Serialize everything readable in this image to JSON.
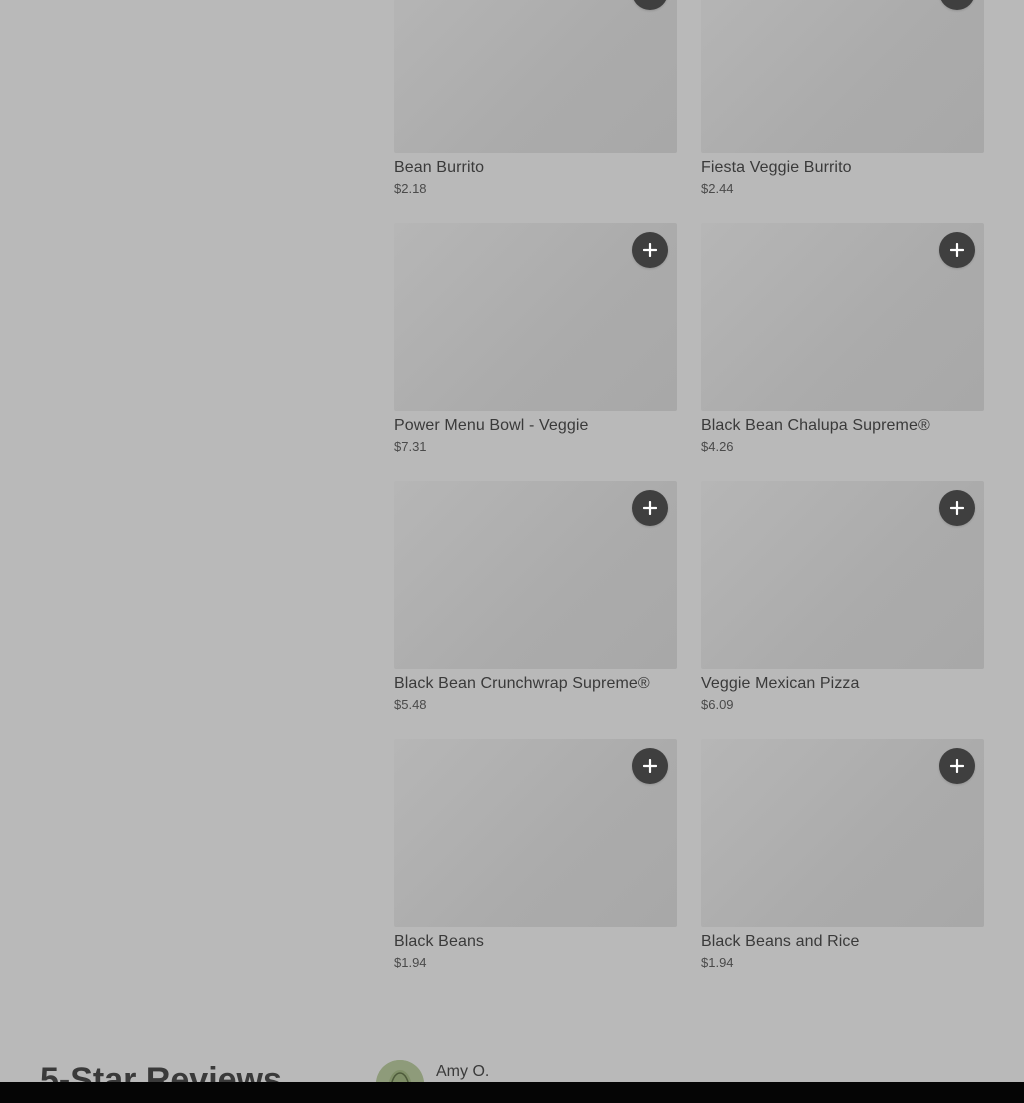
{
  "menu": {
    "items": [
      {
        "name": "Bean Burrito",
        "price": "$2.18"
      },
      {
        "name": "Fiesta Veggie Burrito",
        "price": "$2.44"
      },
      {
        "name": "Power Menu Bowl - Veggie",
        "price": "$7.31"
      },
      {
        "name": "Black Bean Chalupa Supreme®",
        "price": "$4.26"
      },
      {
        "name": "Black Bean Crunchwrap Supreme®",
        "price": "$5.48"
      },
      {
        "name": "Veggie Mexican Pizza",
        "price": "$6.09"
      },
      {
        "name": "Black Beans",
        "price": "$1.94"
      },
      {
        "name": "Black Beans and Rice",
        "price": "$1.94"
      }
    ],
    "add_icon": "plus-icon"
  },
  "reviews": {
    "title": "5-Star Reviews",
    "reviewer_name": "Amy O.",
    "avatar_icon": "avatar-icon"
  },
  "colors": {
    "overlay_background": "#b9b9b9",
    "add_button": "#3f3f3f",
    "text": "#3a3a3a"
  }
}
